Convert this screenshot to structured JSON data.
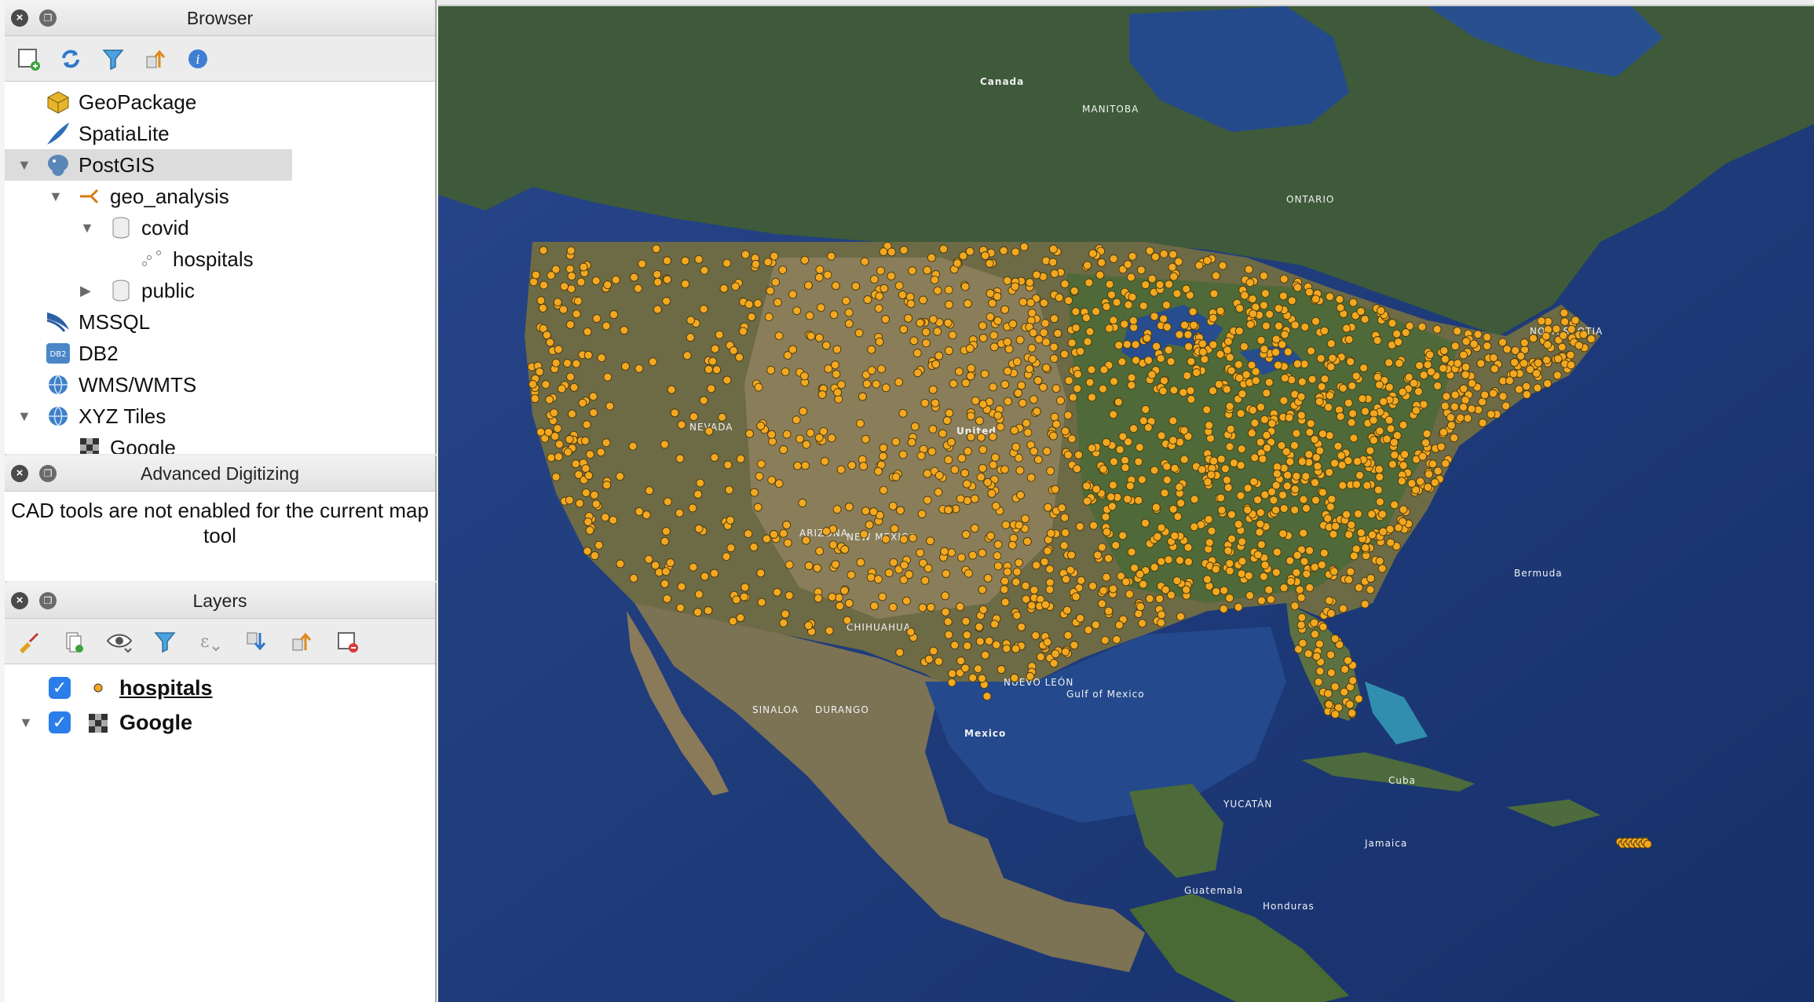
{
  "browser": {
    "title": "Browser",
    "items": [
      {
        "label": "GeoPackage"
      },
      {
        "label": "SpatiaLite"
      },
      {
        "label": "PostGIS"
      },
      {
        "label": "geo_analysis"
      },
      {
        "label": "covid"
      },
      {
        "label": "hospitals"
      },
      {
        "label": "public"
      },
      {
        "label": "MSSQL"
      },
      {
        "label": "DB2"
      },
      {
        "label": "WMS/WMTS"
      },
      {
        "label": "XYZ Tiles"
      },
      {
        "label": "Google"
      }
    ]
  },
  "advanced_digitizing": {
    "title": "Advanced Digitizing",
    "message": "CAD tools are not enabled for the current map tool"
  },
  "layers": {
    "title": "Layers",
    "items": [
      {
        "label": "hospitals",
        "checked": true
      },
      {
        "label": "Google",
        "checked": true
      }
    ]
  },
  "map": {
    "labels": [
      {
        "text": "Canada"
      },
      {
        "text": "United"
      },
      {
        "text": "Mexico"
      },
      {
        "text": "Gulf of Mexico"
      },
      {
        "text": "Cuba"
      },
      {
        "text": "Bermuda"
      },
      {
        "text": "Jamaica"
      },
      {
        "text": "Honduras"
      },
      {
        "text": "Guatemala"
      },
      {
        "text": "NEVADA"
      },
      {
        "text": "ARIZONA"
      },
      {
        "text": "NEW MEXICO"
      },
      {
        "text": "CHIHUAHUA"
      },
      {
        "text": "SINALOA"
      },
      {
        "text": "DURANGO"
      },
      {
        "text": "NUEVO LEÓN"
      },
      {
        "text": "YUCATÁN"
      },
      {
        "text": "ONTARIO"
      },
      {
        "text": "MANITOBA"
      },
      {
        "text": "NOVA SCOTIA"
      }
    ],
    "point_color": "#f3a81f",
    "ocean_color": "#1d3a78"
  }
}
